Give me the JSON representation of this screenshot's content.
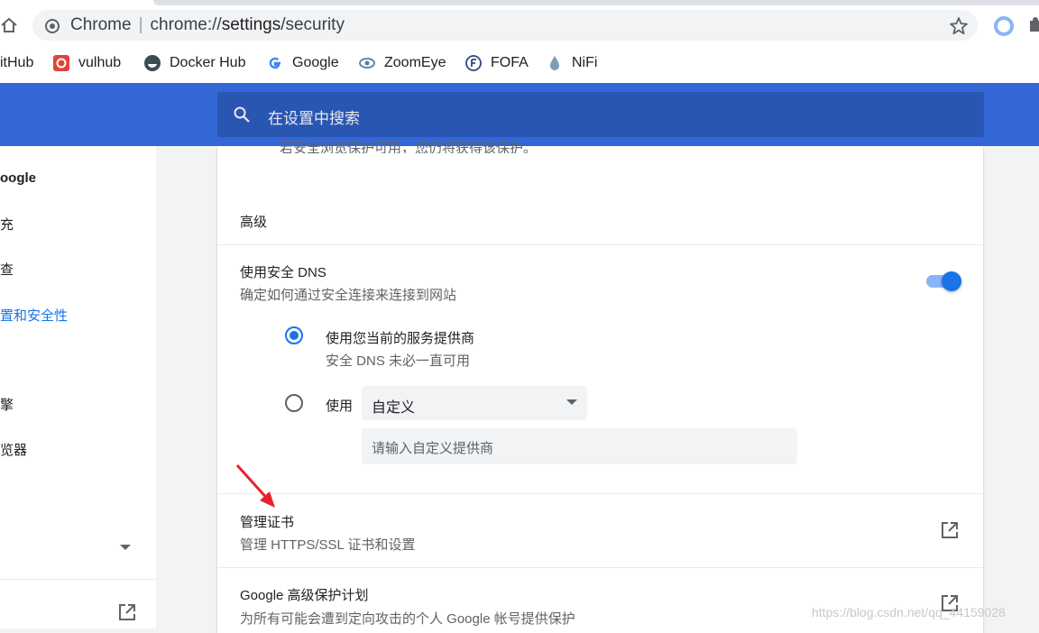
{
  "browser": {
    "omnibox": {
      "label": "Chrome",
      "separator": "|",
      "scheme_host": "chrome://",
      "path": "settings",
      "rest": "/security"
    }
  },
  "bookmarks": [
    {
      "label": "itHub",
      "icon": "github-icon"
    },
    {
      "label": "vulhub",
      "icon": "vulhub-icon"
    },
    {
      "label": "Docker Hub",
      "icon": "docker-icon"
    },
    {
      "label": "Google",
      "icon": "google-icon"
    },
    {
      "label": "ZoomEye",
      "icon": "zoomeye-icon"
    },
    {
      "label": "FOFA",
      "icon": "fofa-icon"
    },
    {
      "label": "NiFi",
      "icon": "nifi-icon"
    }
  ],
  "search": {
    "placeholder": "在设置中搜索"
  },
  "sidebar": {
    "items": [
      {
        "label": "oogle"
      },
      {
        "label": "充"
      },
      {
        "label": "查"
      },
      {
        "label": "置和安全性",
        "active": true
      },
      {
        "label": "擎"
      },
      {
        "label": "览器"
      }
    ]
  },
  "content": {
    "cut_text": "若安全浏览保护可用，您仍将获得该保护。",
    "advanced_heading": "高级",
    "dns": {
      "title": "使用安全 DNS",
      "description": "确定如何通过安全连接来连接到网站",
      "enabled": true,
      "option_current_title": "使用您当前的服务提供商",
      "option_current_sub": "安全 DNS 未必一直可用",
      "option_custom_label": "使用",
      "custom_select_value": "自定义",
      "custom_input_placeholder": "请输入自定义提供商"
    },
    "certs": {
      "title": "管理证书",
      "description": "管理 HTTPS/SSL 证书和设置"
    },
    "app": {
      "title": "Google 高级保护计划",
      "description": "为所有可能会遭到定向攻击的个人 Google 帐号提供保护"
    }
  },
  "watermark": "https://blog.csdn.net/qq_44159028",
  "colors": {
    "header_blue": "#3367d6",
    "accent": "#1a73e8",
    "arrow_red": "#e8202a"
  }
}
